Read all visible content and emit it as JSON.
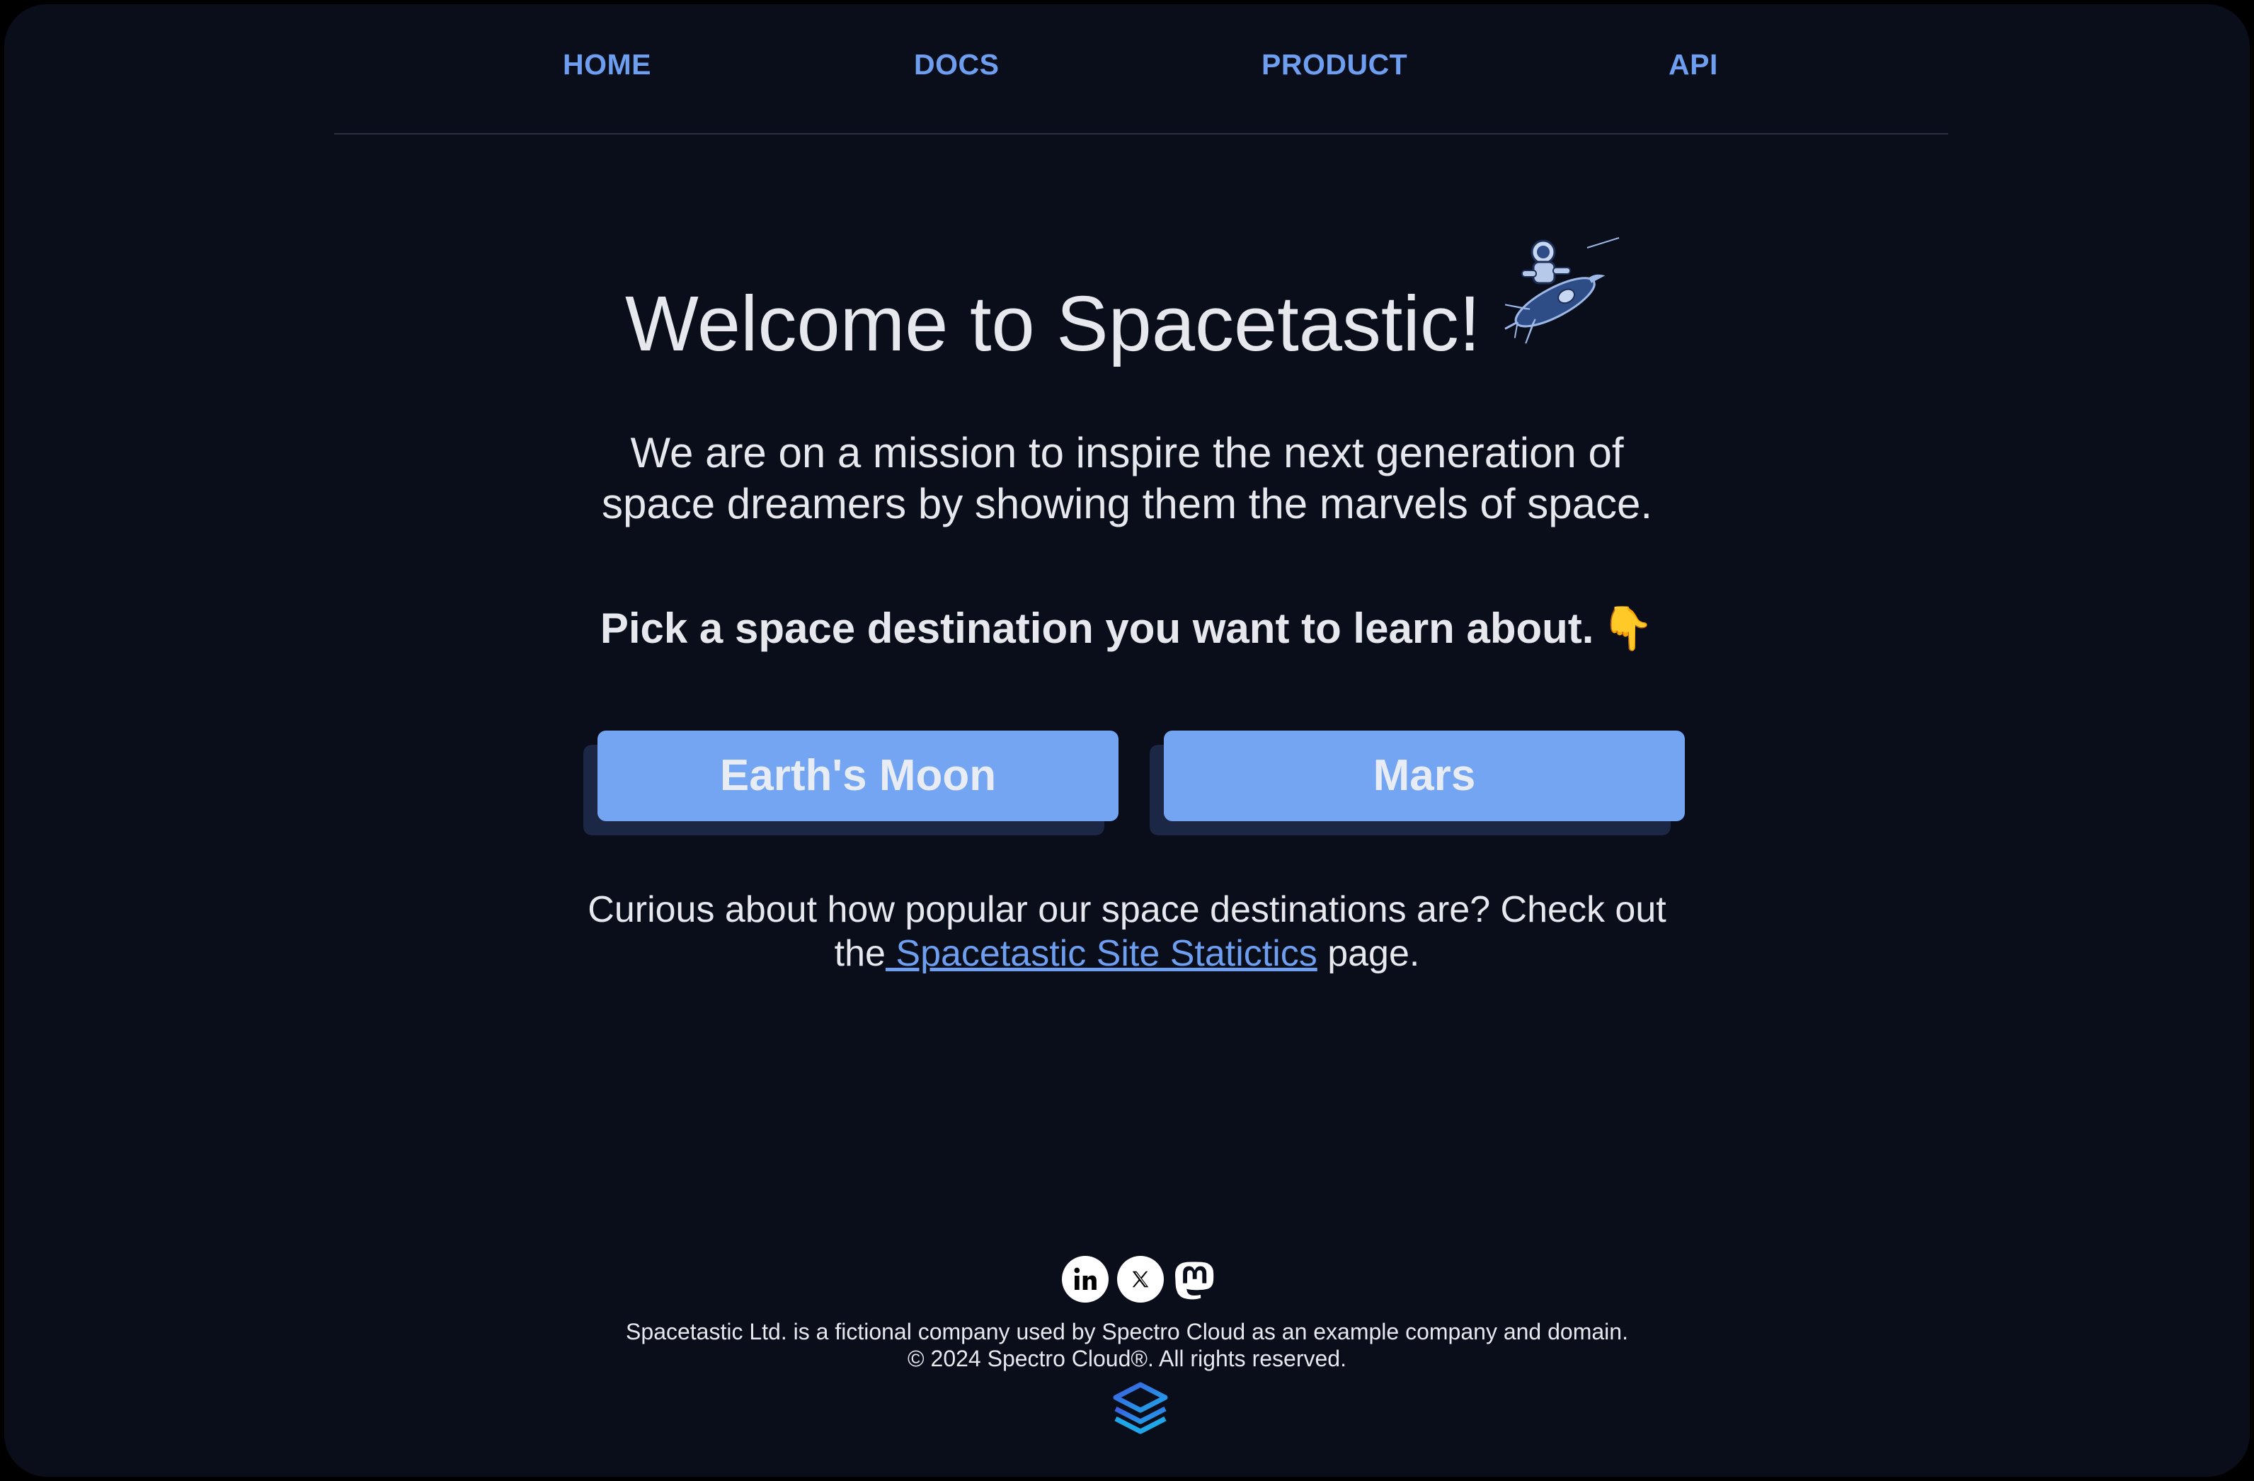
{
  "nav": {
    "items": [
      {
        "label": "HOME"
      },
      {
        "label": "DOCS"
      },
      {
        "label": "PRODUCT"
      },
      {
        "label": "API"
      }
    ]
  },
  "hero": {
    "title": "Welcome to Spacetastic!",
    "rocket_icon": "astronaut-rocket-icon",
    "mission_line1": "We are on a mission to inspire the next generation of",
    "mission_line2": "space dreamers by showing them the marvels of space.",
    "pick_text": "Pick a space destination you want to learn about.",
    "pick_emoji": "👇"
  },
  "destinations": {
    "moon_label": "Earth's Moon",
    "mars_label": "Mars"
  },
  "stats": {
    "line1": "Curious about how popular our space destinations are? Check out",
    "prefix": "the",
    "link_text": " Spacetastic Site Statictics",
    "suffix": " page."
  },
  "footer": {
    "socials": [
      "linkedin-icon",
      "x-icon",
      "mastodon-icon"
    ],
    "disclaimer": "Spacetastic Ltd. is a fictional company used by Spectro Cloud as an example company and domain.",
    "copyright": "© 2024 Spectro Cloud®. All rights reserved.",
    "logo": "spectro-cloud-logo"
  },
  "colors": {
    "background": "#0a0e1a",
    "accent": "#6d9ef0",
    "button": "#74a5f2",
    "text": "#e6e8ee"
  }
}
